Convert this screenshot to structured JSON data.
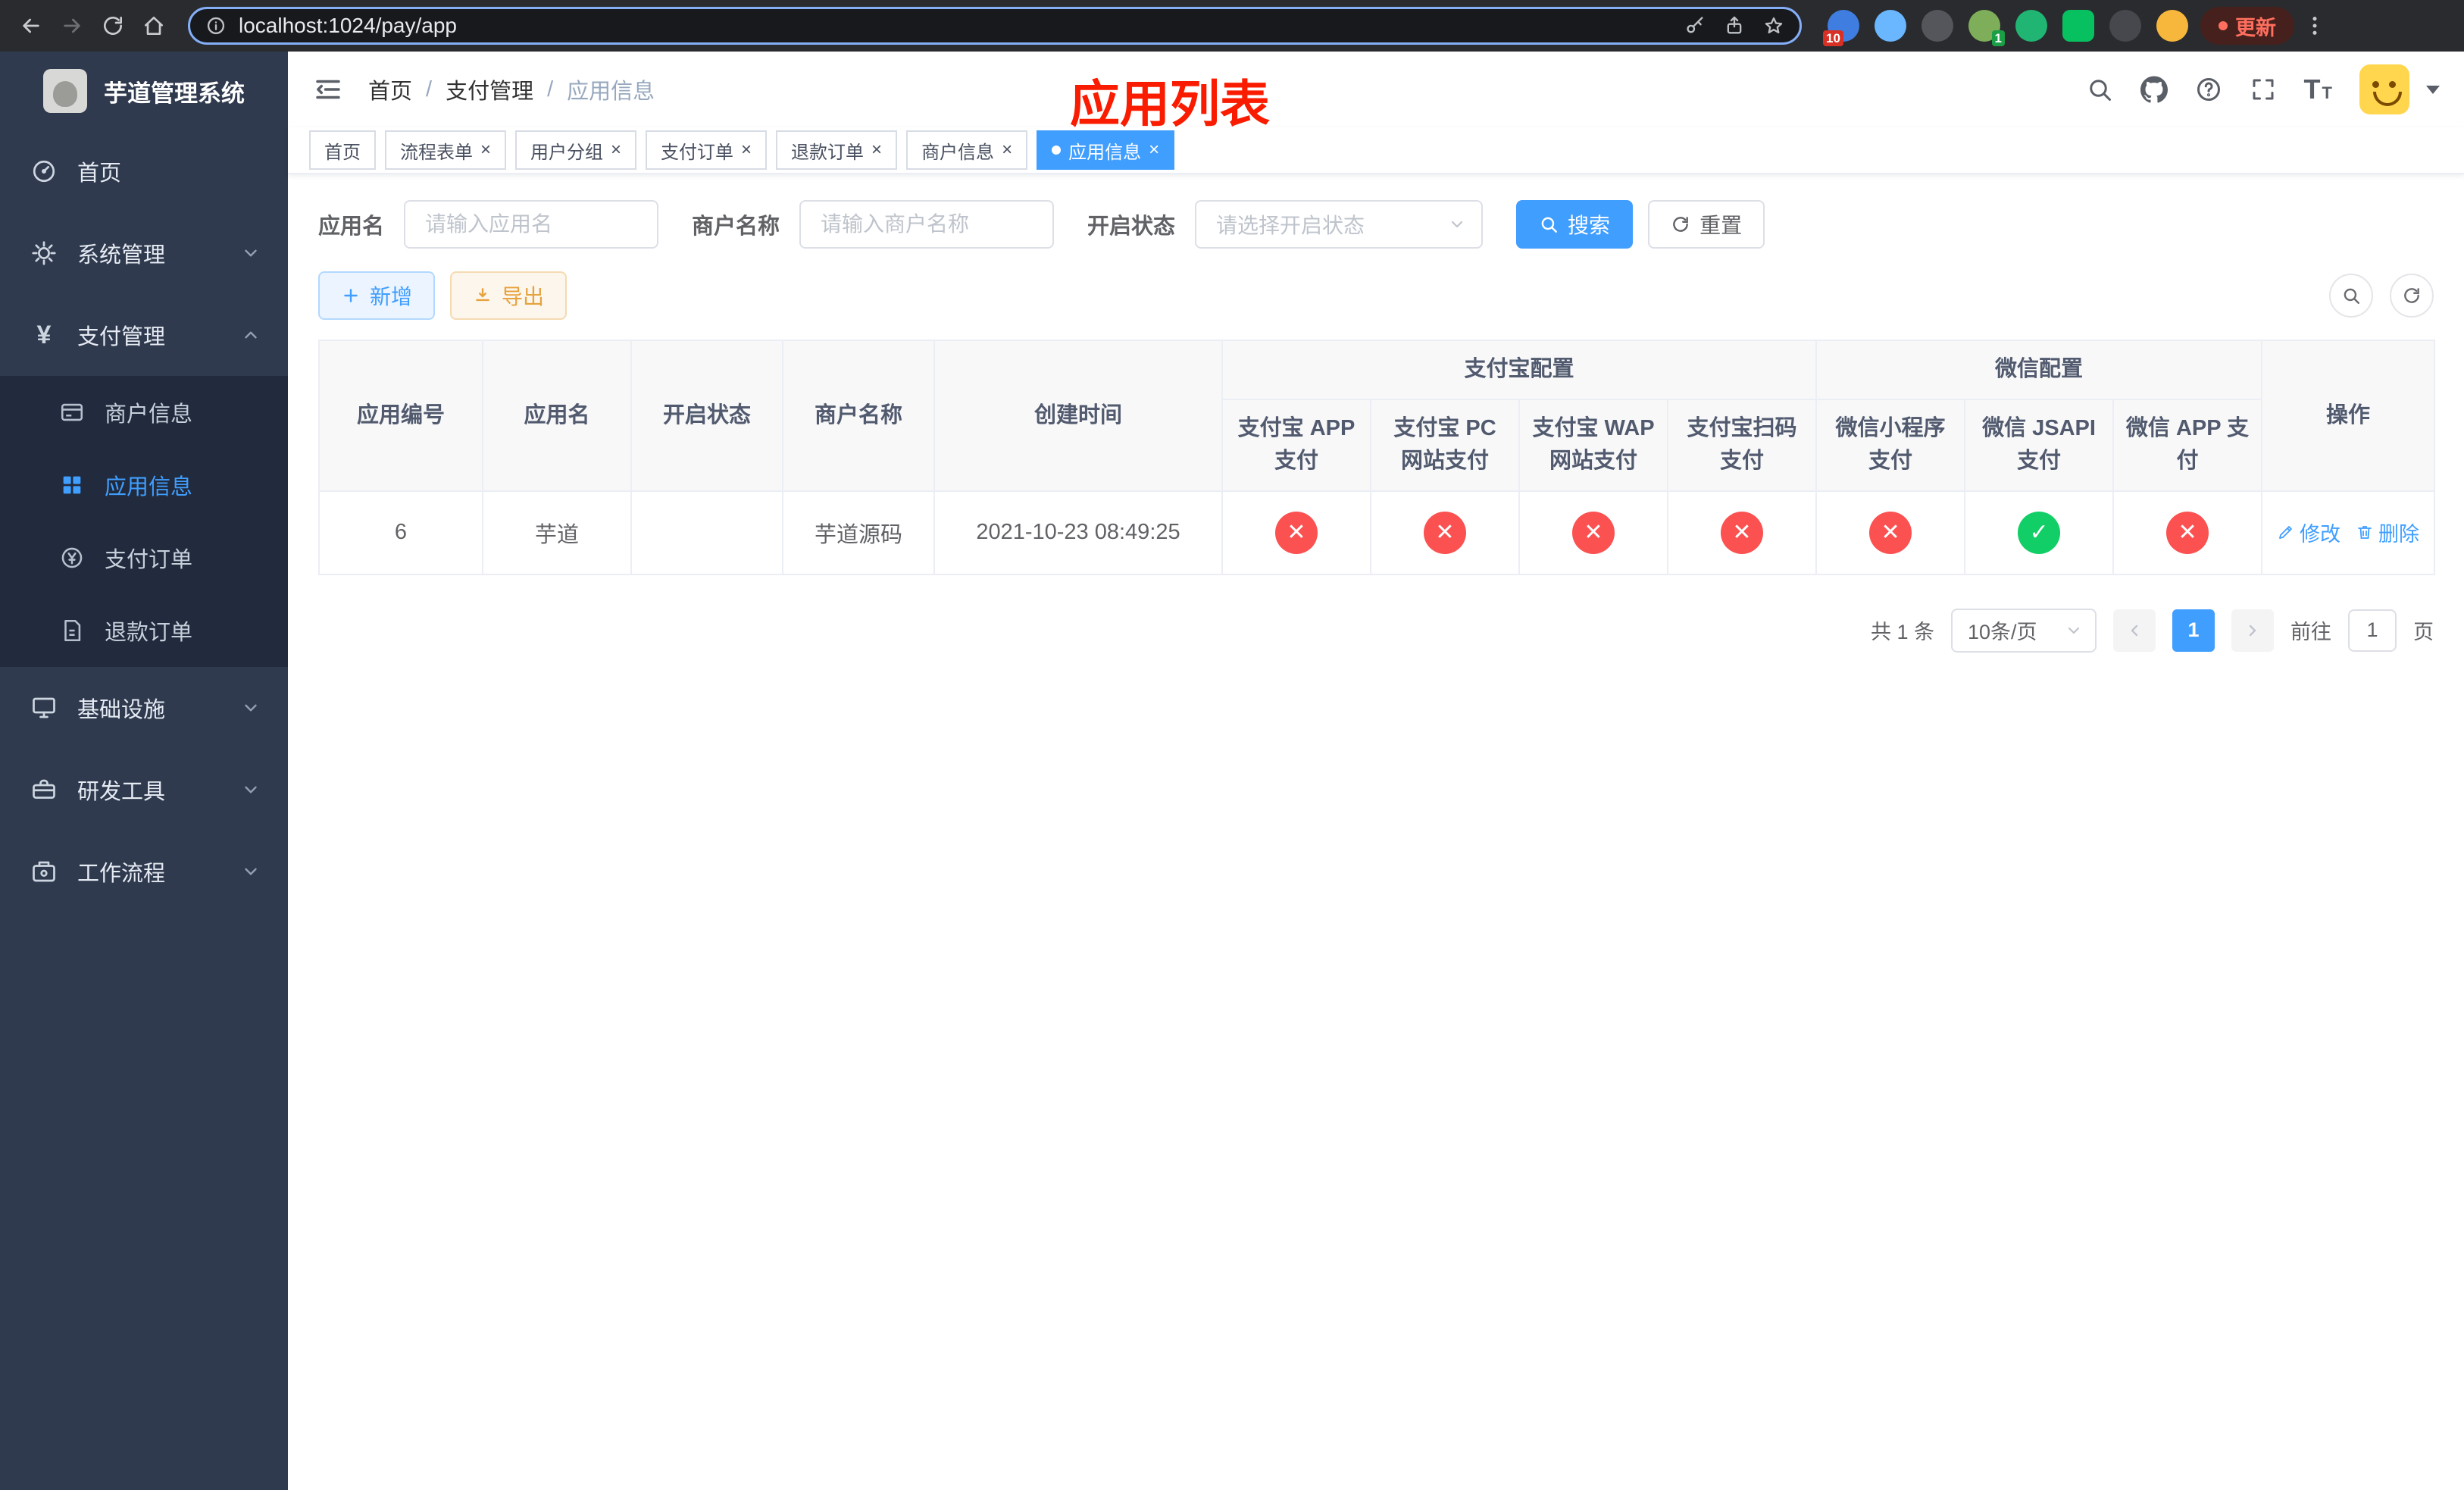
{
  "colors": {
    "accent": "#409eff",
    "danger": "#fb5151",
    "success": "#12ce66",
    "warning": "#e6a23c",
    "overlay_red": "#f91c00",
    "sidebar_bg": "#2f3a4e"
  },
  "browser": {
    "url": "localhost:1024/pay/app",
    "update_label": "更新",
    "badges": {
      "extension": "10",
      "profile_ext": "1"
    }
  },
  "sidebar": {
    "title": "芋道管理系统",
    "items": [
      {
        "label": "首页"
      },
      {
        "label": "系统管理"
      },
      {
        "label": "支付管理",
        "children": [
          {
            "label": "商户信息"
          },
          {
            "label": "应用信息"
          },
          {
            "label": "支付订单"
          },
          {
            "label": "退款订单"
          }
        ]
      },
      {
        "label": "基础设施"
      },
      {
        "label": "研发工具"
      },
      {
        "label": "工作流程"
      }
    ]
  },
  "header": {
    "breadcrumb": {
      "items": [
        "首页",
        "支付管理",
        "应用信息"
      ],
      "separator": "/"
    },
    "overlay_title": "应用列表"
  },
  "tabs": [
    {
      "label": "首页"
    },
    {
      "label": "流程表单"
    },
    {
      "label": "用户分组"
    },
    {
      "label": "支付订单"
    },
    {
      "label": "退款订单"
    },
    {
      "label": "商户信息"
    },
    {
      "label": "应用信息"
    }
  ],
  "filters": {
    "app_name": {
      "label": "应用名",
      "placeholder": "请输入应用名"
    },
    "merchant": {
      "label": "商户名称",
      "placeholder": "请输入商户名称"
    },
    "status": {
      "label": "开启状态",
      "placeholder": "请选择开启状态"
    },
    "search_label": "搜索",
    "reset_label": "重置"
  },
  "toolbar": {
    "add_label": "新增",
    "export_label": "导出"
  },
  "table": {
    "headers": {
      "id": "应用编号",
      "name": "应用名",
      "status": "开启状态",
      "merchant": "商户名称",
      "created": "创建时间",
      "alipay_group": "支付宝配置",
      "wechat_group": "微信配置",
      "config_cols": [
        "支付宝 APP 支付",
        "支付宝 PC 网站支付",
        "支付宝 WAP 网站支付",
        "支付宝扫码支付",
        "微信小程序支付",
        "微信 JSAPI 支付",
        "微信 APP 支付"
      ],
      "actions": "操作"
    },
    "row": {
      "id": "6",
      "name": "芋道",
      "status_on": true,
      "merchant": "芋道源码",
      "created": "2021-10-23 08:49:25",
      "configs": [
        false,
        false,
        false,
        false,
        false,
        true,
        false
      ],
      "edit_label": "修改",
      "delete_label": "删除"
    }
  },
  "pagination": {
    "total": "共 1 条",
    "page_size": "10条/页",
    "current_page": "1",
    "goto_label": "前往",
    "goto_value": "1",
    "page_unit": "页"
  },
  "icons": {
    "x": "✕",
    "check": "✓",
    "yen": "¥"
  }
}
